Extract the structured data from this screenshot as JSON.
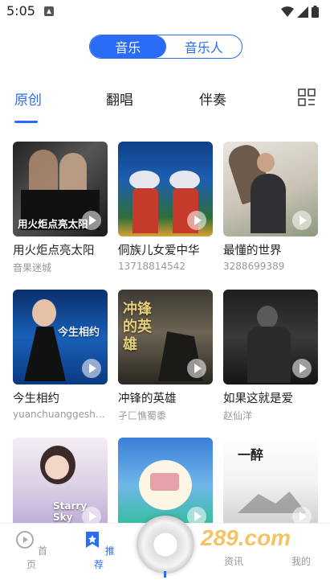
{
  "status_bar": {
    "time": "5:05"
  },
  "segment": {
    "items": [
      "音乐",
      "音乐人"
    ],
    "active": 0
  },
  "tabs": {
    "items": [
      "原创",
      "翻唱",
      "伴奏"
    ],
    "active": 0
  },
  "cards": [
    {
      "title": "用火炬点亮太阳",
      "sub": "音果迷城",
      "cover_text": "用火炬点亮太阳"
    },
    {
      "title": "侗族儿女爱中华",
      "sub": "13718814542",
      "cover_text": ""
    },
    {
      "title": "最懂的世界",
      "sub": "3288699389",
      "cover_text": ""
    },
    {
      "title": "今生相约",
      "sub": "yuanchuanggesh…",
      "cover_text": "今生相约"
    },
    {
      "title": "冲锋的英雄",
      "sub": "孑匚憔蜀黍",
      "cover_text": "冲锋的英雄"
    },
    {
      "title": "如果这就是爱",
      "sub": "赵仙洋",
      "cover_text": ""
    },
    {
      "title": "",
      "sub": "",
      "cover_text": "Starry Sky"
    },
    {
      "title": "",
      "sub": "",
      "cover_text": ""
    },
    {
      "title": "",
      "sub": "",
      "cover_text": "一醉"
    }
  ],
  "bottom_nav": {
    "items": [
      "首页",
      "推荐",
      "资讯",
      "我的"
    ],
    "active": 1
  },
  "watermark": {
    "text": "289.com 手游网"
  },
  "colors": {
    "accent": "#2a6cf6"
  }
}
